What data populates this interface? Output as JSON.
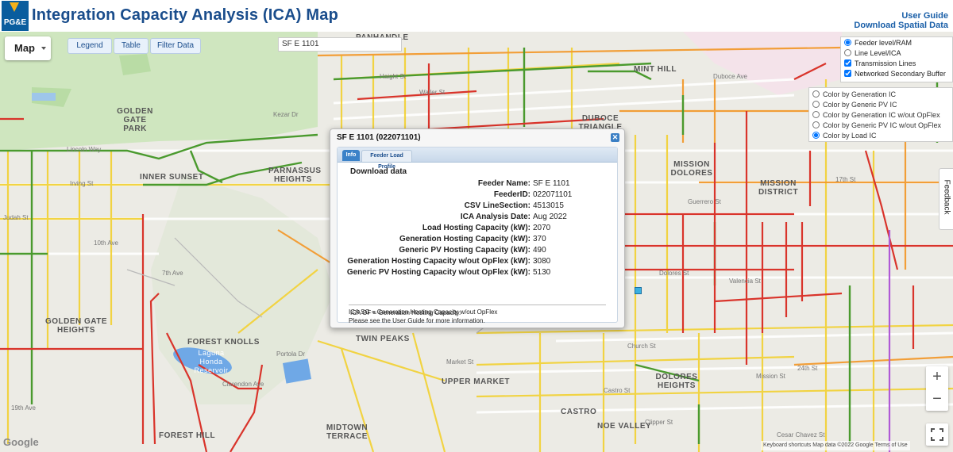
{
  "header": {
    "title": "Integration Capacity Analysis (ICA) Map",
    "logo_text": "PG&E",
    "links": [
      "User Guide",
      "Download Spatial Data"
    ]
  },
  "map_controls": {
    "map_type": "Map",
    "toolbar": [
      "Legend",
      "Table",
      "Filter Data"
    ],
    "search_value": "SF E 1101",
    "layer_options": [
      {
        "label": "Feeder level/RAM",
        "type": "radio",
        "checked": true
      },
      {
        "label": "Line Level/ICA",
        "type": "radio",
        "checked": false
      },
      {
        "label": "Transmission Lines",
        "type": "checkbox",
        "checked": true
      },
      {
        "label": "Networked Secondary Buffer",
        "type": "checkbox",
        "checked": true
      }
    ],
    "color_options": [
      {
        "label": "Color by Generation IC",
        "checked": false
      },
      {
        "label": "Color by Generic PV IC",
        "checked": false
      },
      {
        "label": "Color by Generation IC w/out OpFlex",
        "checked": false
      },
      {
        "label": "Color by Generic PV IC w/out OpFlex",
        "checked": false
      },
      {
        "label": "Color by Load IC",
        "checked": true
      }
    ],
    "feedback": "Feedback",
    "zoom_in": "+",
    "zoom_out": "−",
    "google": "Google",
    "attribution": "Keyboard shortcuts   Map data ©2022 Google   Terms of Use"
  },
  "neighborhoods": [
    {
      "text": "PANHANDLE"
    },
    {
      "text": "GOLDEN GATE PARK"
    },
    {
      "text": "MINT HILL"
    },
    {
      "text": "DUBOCE TRIANGLE"
    },
    {
      "text": "INNER SUNSET"
    },
    {
      "text": "PARNASSUS HEIGHTS"
    },
    {
      "text": "MISSION DOLORES"
    },
    {
      "text": "MISSION DISTRICT"
    },
    {
      "text": "GOLDEN GATE HEIGHTS"
    },
    {
      "text": "FOREST KNOLLS"
    },
    {
      "text": "TWIN PEAKS"
    },
    {
      "text": "UPPER MARKET"
    },
    {
      "text": "DOLORES HEIGHTS"
    },
    {
      "text": "CASTRO"
    },
    {
      "text": "NOE VALLEY"
    },
    {
      "text": "MIDTOWN TERRACE"
    },
    {
      "text": "FOREST HILL"
    },
    {
      "text": "Laguna Honda Reservoir"
    }
  ],
  "streets": [
    "Lincoln Way",
    "Irving St",
    "Judah St",
    "7th Ave",
    "10th Ave",
    "Kezar Dr",
    "Haight St",
    "Waller St",
    "Duboce Ave",
    "Market St",
    "24th St",
    "Clipper St",
    "Cesar Chavez St",
    "19th Ave",
    "Dolores St",
    "Guerrero St",
    "Valencia St",
    "Mission St",
    "17th St",
    "Clarendon Ave",
    "Portola Dr",
    "Castro St",
    "Church St"
  ],
  "popup": {
    "title": "SF E 1101 (022071101)",
    "tabs": [
      "Info",
      "Feeder Load Profile"
    ],
    "download_label": "Download data",
    "fields": [
      {
        "key": "Feeder Name:",
        "value": "SF E 1101"
      },
      {
        "key": "FeederID:",
        "value": "022071101"
      },
      {
        "key": "CSV LineSection:",
        "value": "4513015"
      },
      {
        "key": "ICA Analysis Date:",
        "value": "Aug 2022"
      },
      {
        "key": "Load Hosting Capacity (kW):",
        "value": "2070"
      },
      {
        "key": "Generation Hosting Capacity (kW):",
        "value": "370"
      },
      {
        "key": "Generic PV Hosting Capacity (kW):",
        "value": "490"
      },
      {
        "key": "Generation Hosting Capacity w/out OpFlex (kW):",
        "value": "3080"
      },
      {
        "key": "Generic PV Hosting Capacity w/out OpFlex (kW):",
        "value": "5130"
      }
    ],
    "notes": [
      "ICA OF = Generation Hosting Capacity.",
      "ICA SG = Generation Hosting Capacity w/out OpFlex",
      "Please see the User Guide for more information."
    ]
  },
  "colors": {
    "title": "#1a4d8c",
    "line_red": "#d9342b",
    "line_orange": "#f29a2e",
    "line_yellow": "#f2d23a",
    "line_green": "#4a9a2e",
    "line_purple": "#b05ad6",
    "park": "#cfe6bf",
    "water": "#6fa8e6"
  }
}
